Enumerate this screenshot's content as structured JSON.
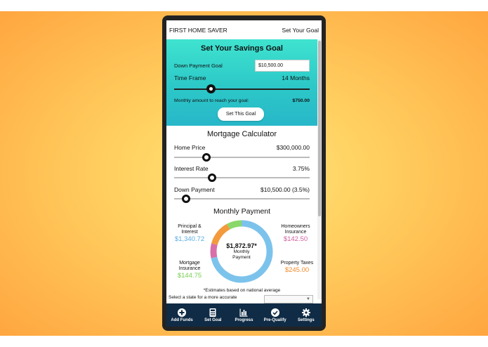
{
  "app": {
    "title": "FIRST HOME SAVER",
    "header_link": "Set Your Goal"
  },
  "savings": {
    "heading": "Set Your Savings Goal",
    "down_payment_label": "Down Payment Goal",
    "down_payment_value": "$10,500.00",
    "time_frame_label": "Time Frame",
    "time_frame_value": "14 Months",
    "time_frame_position": 0.27,
    "monthly_label": "Monthly amount to reach your goal:",
    "monthly_value": "$750.00",
    "button_label": "Set This Goal"
  },
  "mortgage": {
    "heading": "Mortgage Calculator",
    "home_price_label": "Home Price",
    "home_price_value": "$300,000.00",
    "home_price_position": 0.24,
    "interest_label": "Interest Rate",
    "interest_value": "3.75%",
    "interest_position": 0.28,
    "down_payment_label": "Down Payment",
    "down_payment_value": "$10,500.00 (3.5%)",
    "down_payment_position": 0.09
  },
  "monthly_payment": {
    "heading": "Monthly Payment",
    "total": "$1,872.97*",
    "center_label": "Monthly Payment",
    "segments": [
      {
        "name": "Principal & Interest",
        "value": "$1,340.72",
        "amount": 1340.72,
        "color": "#7cc3ec"
      },
      {
        "name": "Homeowners Insurance",
        "value": "$142.50",
        "amount": 142.5,
        "color": "#d86fa8"
      },
      {
        "name": "Property Taxes",
        "value": "$245.00",
        "amount": 245.0,
        "color": "#f39a3c"
      },
      {
        "name": "Mortgage Insurance",
        "value": "$144.75",
        "amount": 144.75,
        "color": "#8ad86a"
      }
    ],
    "note": "*Estimates based on national average",
    "state_prompt": "Select a state for a more accurate"
  },
  "nav": [
    {
      "label": "Add Funds",
      "icon": "plus-circle-icon"
    },
    {
      "label": "Set Goal",
      "icon": "calculator-icon"
    },
    {
      "label": "Progress",
      "icon": "bar-chart-icon"
    },
    {
      "label": "Pre-Qualify",
      "icon": "check-circle-icon"
    },
    {
      "label": "Settings",
      "icon": "gear-icon"
    }
  ]
}
